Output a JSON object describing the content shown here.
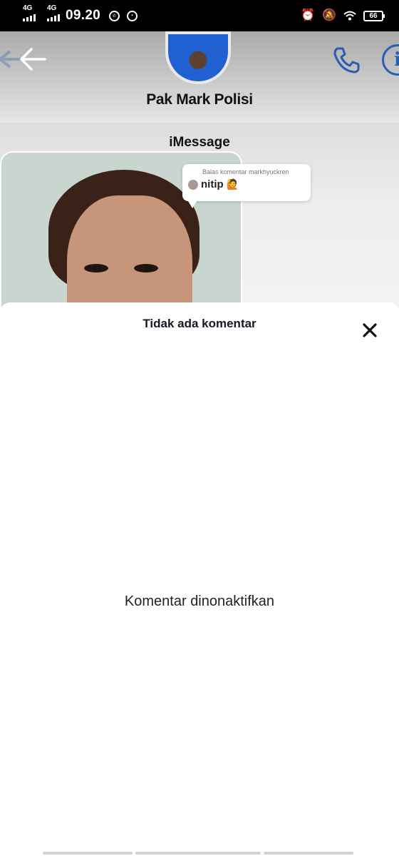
{
  "status_bar": {
    "network_1": "4G",
    "network_2": "4G",
    "time": "09.20",
    "apps": [
      "whatsapp-icon",
      "line-icon"
    ],
    "right_icons": [
      "alarm-icon",
      "bell-off-icon",
      "wifi-icon"
    ],
    "battery": "66"
  },
  "video": {
    "contact_name": "Pak Mark Polisi",
    "service_label": "iMessage",
    "reply": {
      "meta": "Balas komentar markhyuckren",
      "text": "nitip",
      "emoji": "🙋"
    }
  },
  "sheet": {
    "title": "Tidak ada komentar",
    "disabled_message": "Komentar dinonaktifkan"
  },
  "colors": {
    "accent_blue": "#2a5db0",
    "sheet_bg": "#ffffff",
    "status_bg": "#000000"
  }
}
